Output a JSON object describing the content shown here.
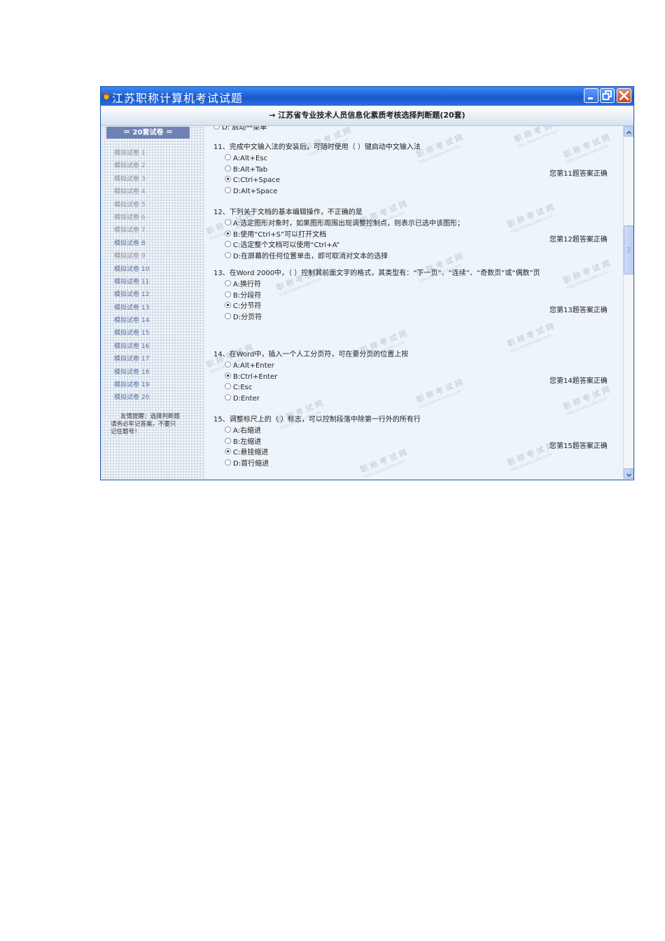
{
  "window": {
    "title": "江苏职称计算机考试试题",
    "header": "→ 江苏省专业技术人员信息化素质考核选择判断题(20套)"
  },
  "sidebar": {
    "heading": "＝ 20套试卷 ＝",
    "papers": [
      "模拟试卷 1",
      "模拟试卷 2",
      "模拟试卷 3",
      "模拟试卷 4",
      "模拟试卷 5",
      "模拟试卷 6",
      "模拟试卷 7",
      "模拟试卷 8",
      "模拟试卷 9",
      "模拟试卷 10",
      "模拟试卷 11",
      "模拟试卷 12",
      "模拟试卷 13",
      "模拟试卷 14",
      "模拟试卷 15",
      "模拟试卷 16",
      "模拟试卷 17",
      "模拟试卷 18",
      "模拟试卷 19",
      "模拟试卷 20"
    ],
    "reminder": "友情提醒：选择判断题请务必牢记答案，不要只记住题号！"
  },
  "content": {
    "partial_top_option": "D: 启动一菜单",
    "questions": [
      {
        "text": "11、完成中文输入法的安装后，可随时使用（ ）键启动中文输入法",
        "options": [
          "A:Alt+Esc",
          "B:Alt+Tab",
          "C:Ctrl+Space",
          "D:Alt+Space"
        ],
        "selected": 2,
        "result": "您第11题答案正确"
      },
      {
        "text": "12、下列关于文档的基本编辑操作，不正确的是",
        "options": [
          "A:选定图形对象时，如果图形周围出现调整控制点，则表示已选中该图形；",
          "B:使用“Ctrl+S”可以打开文档",
          "C:选定整个文档可以使用“Ctrl+A”",
          "D:在屏幕的任何位置单击，即可取消对文本的选择"
        ],
        "selected": 1,
        "result": "您第12题答案正确"
      },
      {
        "text": "13、在Word 2000中，（ ）控制其前面文字的格式，其类型有：“下一页”、“连续”、“奇数页”或“偶数”页",
        "options": [
          "A:换行符",
          "B:分段符",
          "C:分节符",
          "D:分页符"
        ],
        "selected": 2,
        "result": "您第13题答案正确"
      },
      {
        "text": "14、在Word中，插入一个人工分页符，可在要分页的位置上按",
        "options": [
          "A:Alt+Enter",
          "B:Ctrl+Enter",
          "C:Esc",
          "D:Enter"
        ],
        "selected": 1,
        "result": "您第14题答案正确"
      },
      {
        "text": "15、调整标尺上的（ ）标志，可以控制段落中除第一行外的所有行",
        "options": [
          "A:右缩进",
          "B:左缩进",
          "C:悬挂缩进",
          "D:首行缩进"
        ],
        "selected": 2,
        "result": "您第15题答案正确"
      }
    ],
    "watermark": {
      "text": "职 称 考 试 网",
      "url": "http://www.xz4o.com"
    }
  }
}
